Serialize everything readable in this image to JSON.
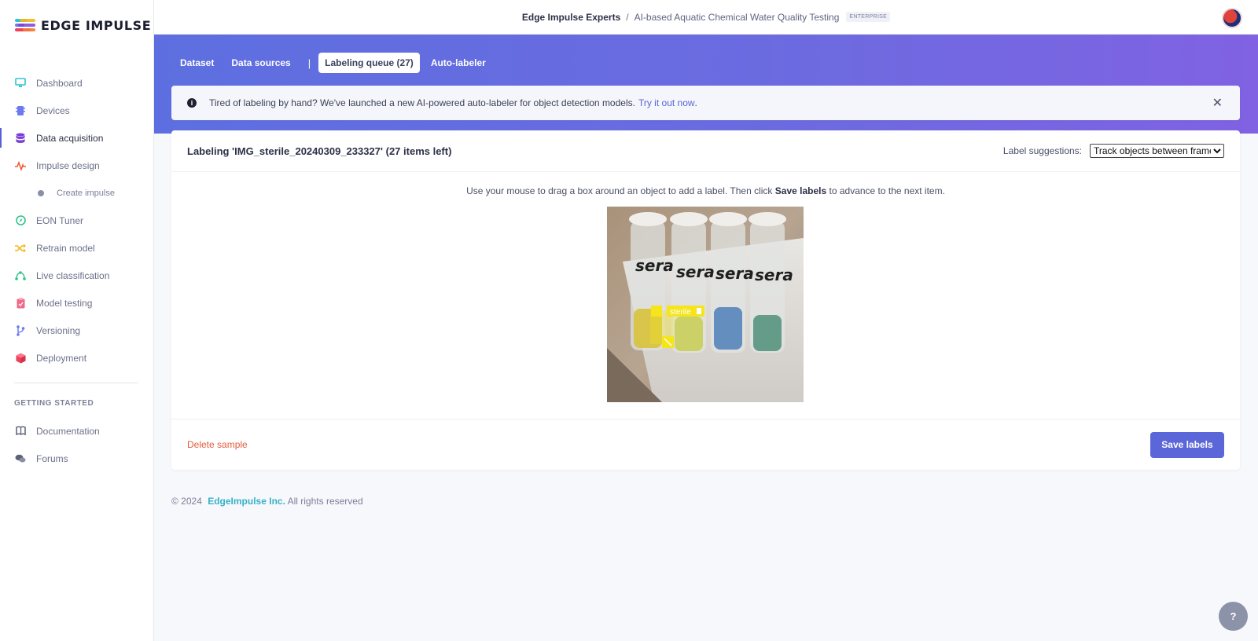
{
  "brand": {
    "name": "EDGE IMPULSE"
  },
  "sidebar": {
    "items": [
      {
        "label": "Dashboard",
        "icon": "monitor-icon",
        "color": "#2ec4d6"
      },
      {
        "label": "Devices",
        "icon": "chip-icon",
        "color": "#6b7af0"
      },
      {
        "label": "Data acquisition",
        "icon": "database-icon",
        "color": "#7a3fd6"
      },
      {
        "label": "Impulse design",
        "icon": "pulse-icon",
        "color": "#f0603a"
      },
      {
        "label": "Create impulse",
        "icon": "dot-icon"
      },
      {
        "label": "EON Tuner",
        "icon": "compass-icon",
        "color": "#2ec48a"
      },
      {
        "label": "Retrain model",
        "icon": "shuffle-icon",
        "color": "#f2b81a"
      },
      {
        "label": "Live classification",
        "icon": "nodes-icon",
        "color": "#2ec48a"
      },
      {
        "label": "Model testing",
        "icon": "clipboard-icon",
        "color": "#f06a8a"
      },
      {
        "label": "Versioning",
        "icon": "branch-icon",
        "color": "#6b7af0"
      },
      {
        "label": "Deployment",
        "icon": "cube-icon",
        "color": "#f0405a"
      }
    ],
    "section_title": "GETTING STARTED",
    "help_items": [
      {
        "label": "Documentation",
        "icon": "book-icon"
      },
      {
        "label": "Forums",
        "icon": "chat-icon"
      }
    ]
  },
  "header": {
    "owner": "Edge Impulse Experts",
    "separator": "/",
    "project": "AI-based Aquatic Chemical Water Quality Testing",
    "badge": "ENTERPRISE"
  },
  "tabs": [
    {
      "label": "Dataset"
    },
    {
      "label": "Data sources"
    },
    {
      "label": "Labeling queue (27)",
      "active": true
    },
    {
      "label": "Auto-labeler"
    }
  ],
  "banner": {
    "text": "Tired of labeling by hand? We've launched a new AI-powered auto-labeler for object detection models.",
    "link": "Try it out now",
    "suffix": "."
  },
  "labeling": {
    "title": "Labeling 'IMG_sterile_20240309_233327' (27 items left)",
    "suggestions_label": "Label suggestions:",
    "suggestions_value": "Track objects between frames",
    "instruction_pre": "Use your mouse to drag a box around an object to add a label. Then click",
    "instruction_bold": "Save labels",
    "instruction_post": "to advance to the next item.",
    "box_label": "sterile",
    "vial_text": "sera",
    "delete": "Delete sample",
    "save": "Save labels"
  },
  "footer": {
    "copyright": "© 2024",
    "company": "EdgeImpulse Inc.",
    "rights": "All rights reserved"
  },
  "help_button": "?"
}
